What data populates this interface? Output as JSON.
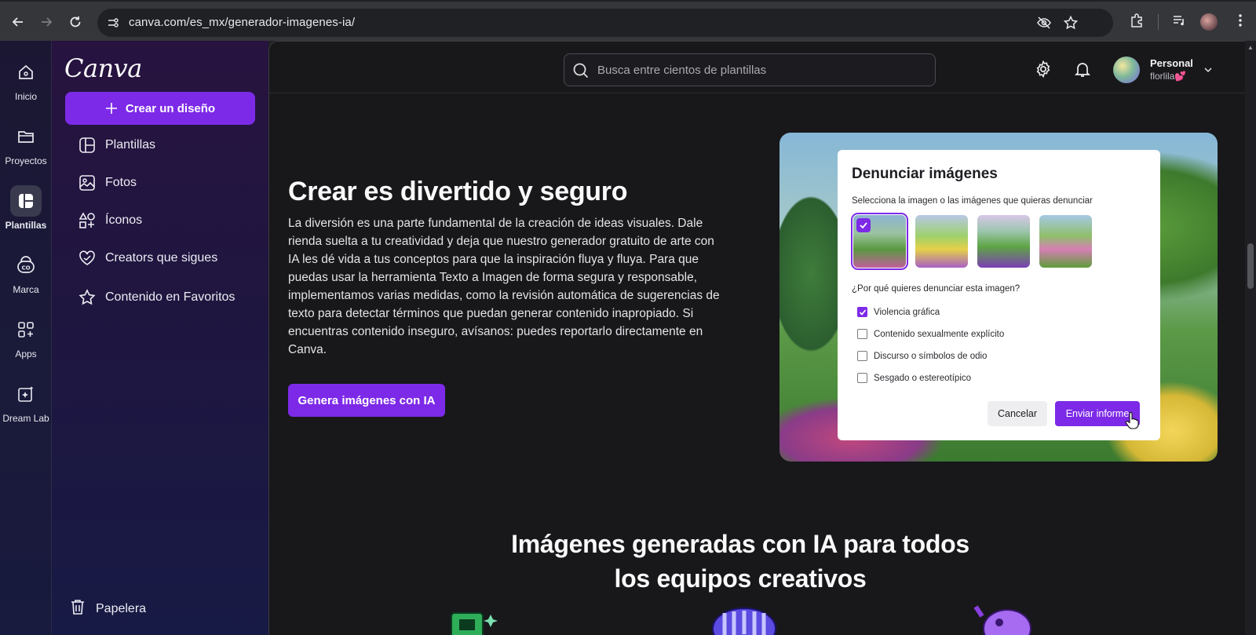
{
  "browser": {
    "url": "canva.com/es_mx/generador-imagenes-ia/"
  },
  "rail": {
    "items": [
      {
        "label": "Inicio",
        "icon": "home-icon"
      },
      {
        "label": "Proyectos",
        "icon": "folder-icon"
      },
      {
        "label": "Plantillas",
        "icon": "templates-icon",
        "active": true
      },
      {
        "label": "Marca",
        "icon": "brand-icon"
      },
      {
        "label": "Apps",
        "icon": "apps-icon"
      },
      {
        "label": "Dream Lab",
        "icon": "dream-lab-icon"
      }
    ]
  },
  "sidebar": {
    "logo": "Canva",
    "create_label": "Crear un diseño",
    "items": [
      {
        "label": "Plantillas",
        "icon": "templates-icon"
      },
      {
        "label": "Fotos",
        "icon": "photo-icon"
      },
      {
        "label": "Íconos",
        "icon": "shapes-icon"
      },
      {
        "label": "Creators que sigues",
        "icon": "heart-icon"
      },
      {
        "label": "Contenido en Favoritos",
        "icon": "star-icon"
      }
    ],
    "trash_label": "Papelera"
  },
  "topbar": {
    "search_placeholder": "Busca entre cientos de plantillas",
    "account_name": "Personal",
    "account_user": "florlila💕"
  },
  "hero": {
    "title": "Crear es divertido y seguro",
    "body": "La diversión es una parte fundamental de la creación de ideas visuales. Dale rienda suelta a tu creatividad y deja que nuestro generador gratuito de arte con IA les dé vida a tus conceptos para que la inspiración fluya y fluya. Para que puedas usar la herramienta Texto a Imagen de forma segura y responsable, implementamos varias medidas, como la revisión automática de sugerencias de texto para detectar términos que puedan generar contenido inapropiado. Si encuentras contenido inseguro, avísanos: puedes reportarlo directamente en Canva.",
    "cta_label": "Genera imágenes con IA"
  },
  "report_dialog": {
    "title": "Denunciar imágenes",
    "subtitle": "Selecciona la imagen o las imágenes que quieras denunciar",
    "question": "¿Por qué quieres denunciar esta imagen?",
    "options": [
      {
        "label": "Violencia gráfica",
        "checked": true
      },
      {
        "label": "Contenido sexualmente explícito",
        "checked": false
      },
      {
        "label": "Discurso o símbolos de odio",
        "checked": false
      },
      {
        "label": "Sesgado o estereotípico",
        "checked": false
      }
    ],
    "cancel_label": "Cancelar",
    "submit_label": "Enviar informe"
  },
  "section": {
    "title_line1": "Imágenes generadas con IA para todos",
    "title_line2": "los equipos creativos"
  },
  "colors": {
    "accent": "#7d2ae8",
    "background": "#18181b"
  }
}
